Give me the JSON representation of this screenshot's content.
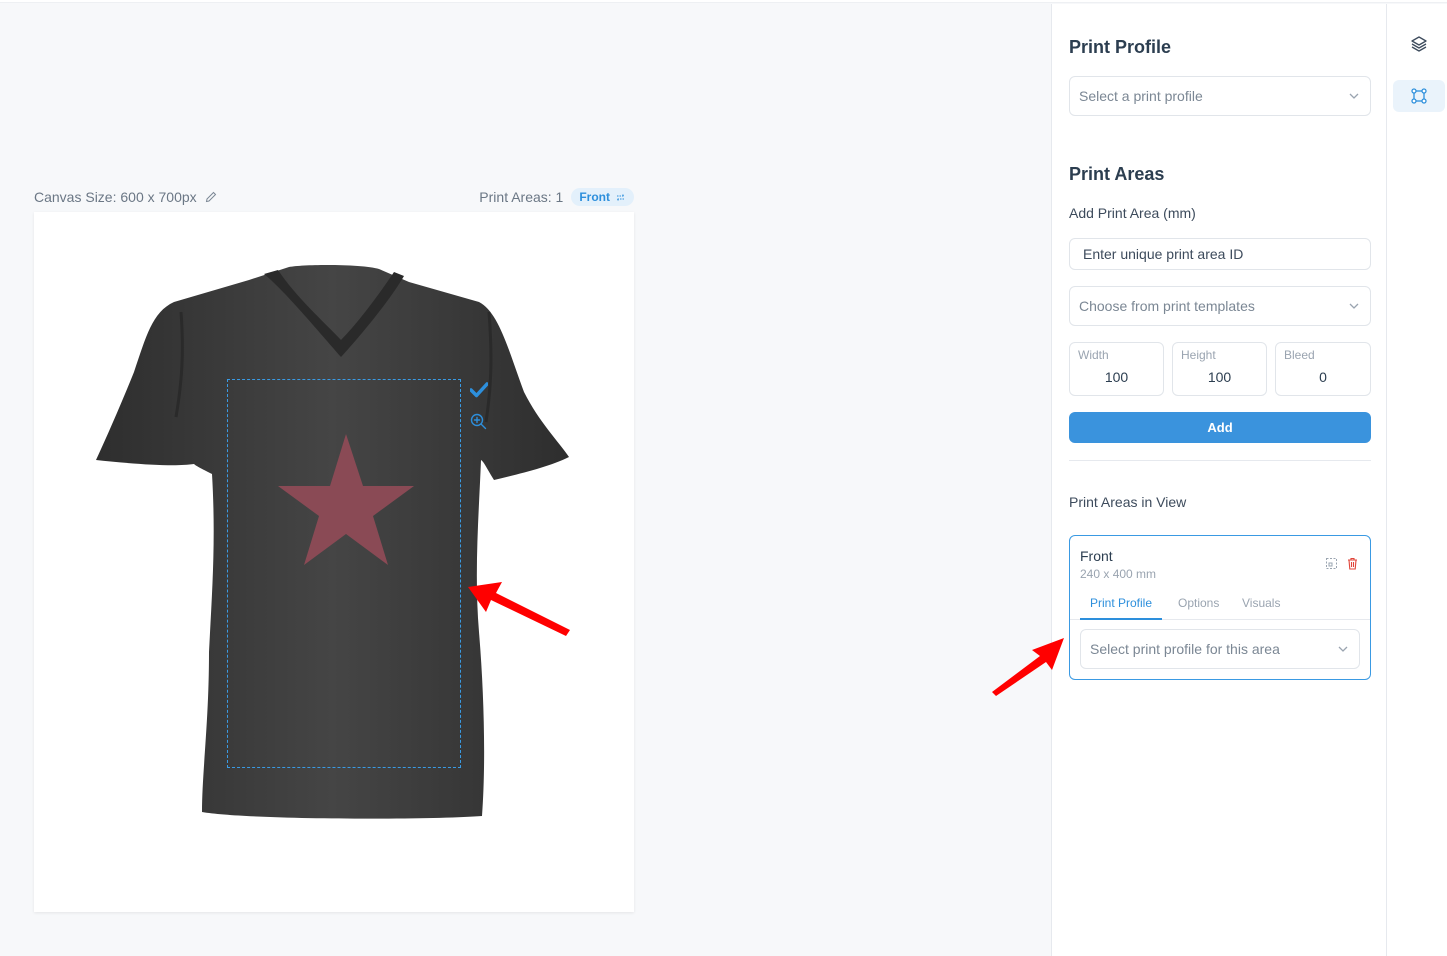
{
  "canvas": {
    "size_label": "Canvas Size: 600 x 700px",
    "print_areas_label": "Print Areas: 1",
    "active_area_badge": "Front"
  },
  "panel": {
    "print_profile_heading": "Print Profile",
    "print_profile_select": "Select a print profile",
    "print_areas_heading": "Print Areas",
    "add_area_label": "Add Print Area (mm)",
    "area_id_placeholder": "Enter unique print area ID",
    "template_select": "Choose from print templates",
    "dimensions": [
      {
        "label": "Width",
        "value": "100"
      },
      {
        "label": "Height",
        "value": "100"
      },
      {
        "label": "Bleed",
        "value": "0"
      }
    ],
    "add_button": "Add",
    "areas_in_view_label": "Print Areas in View",
    "area_card": {
      "title": "Front",
      "size": "240 x 400 mm",
      "tabs": [
        "Print Profile",
        "Options",
        "Visuals"
      ],
      "active_tab": "Print Profile",
      "profile_select": "Select print profile for this area"
    }
  },
  "rail": {
    "items": [
      {
        "icon": "layers-icon",
        "active": false
      },
      {
        "icon": "print-area-icon",
        "active": true
      }
    ]
  },
  "colors": {
    "accent": "#3a93dd",
    "shirt": "#3c3c3c",
    "star": "#8a4a55",
    "annotation_arrow": "#ff0000"
  }
}
